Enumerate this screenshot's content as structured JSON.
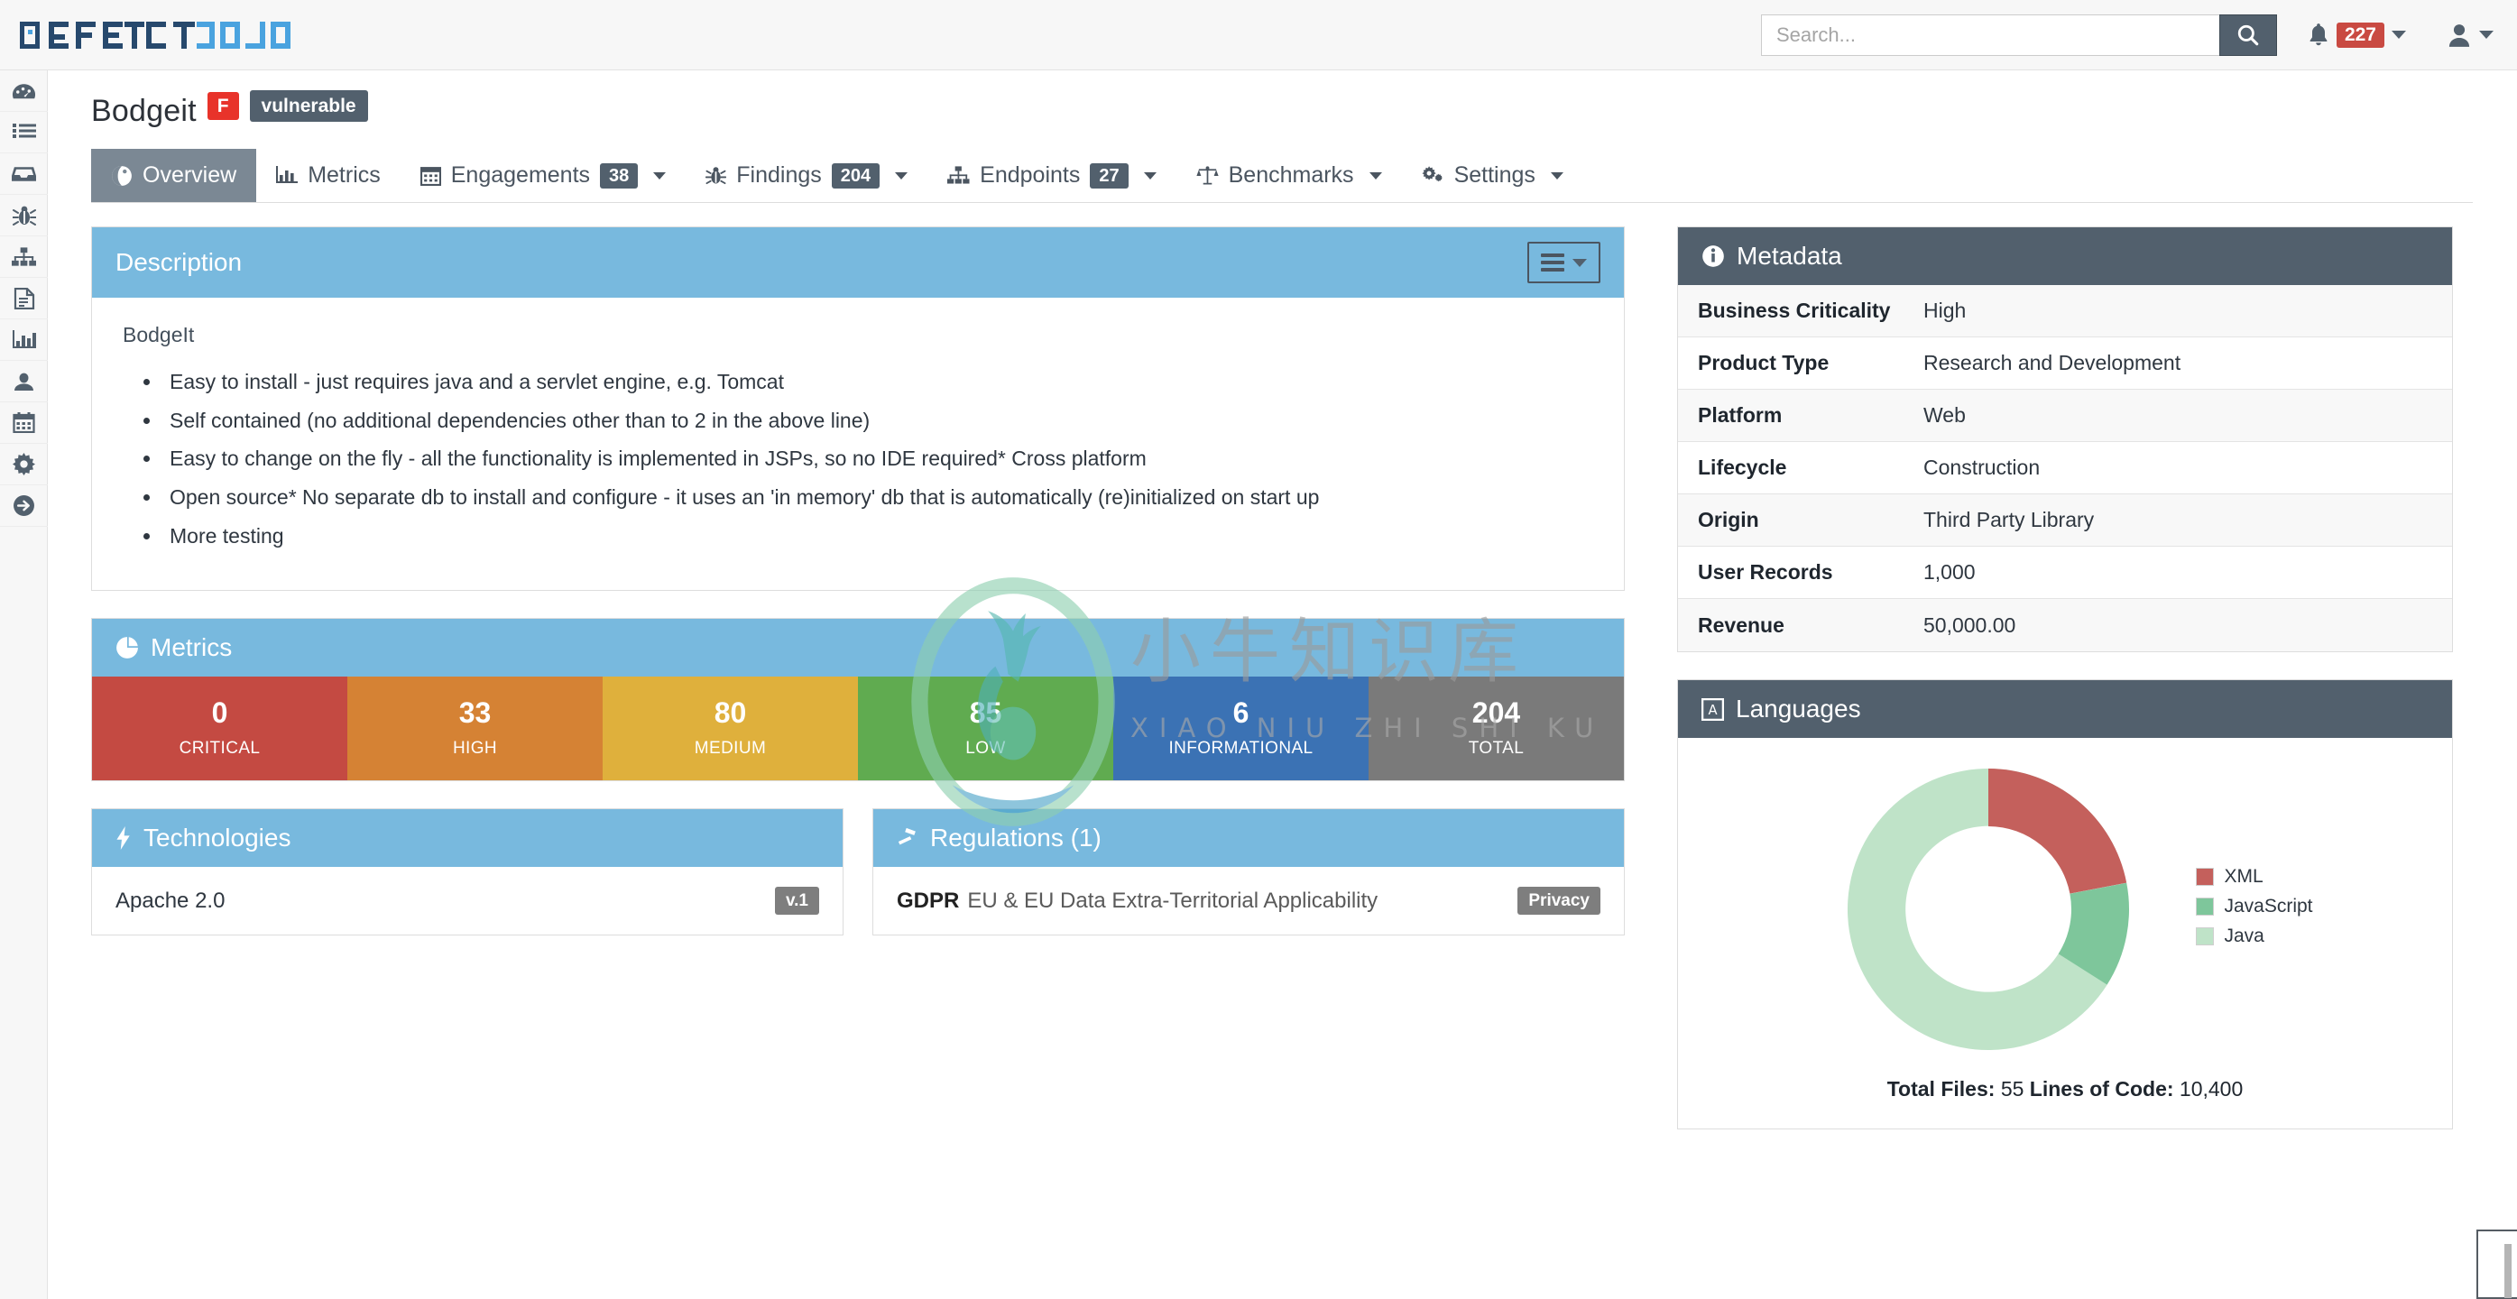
{
  "app": {
    "brand_defect": "DEFECT",
    "brand_dojo": "DOJO"
  },
  "navbar": {
    "search_placeholder": "Search...",
    "search_value": "",
    "search_icon": "search-icon",
    "notification_count": "227",
    "bell_icon": "bell-icon",
    "user_icon": "user-icon"
  },
  "sidebar": {
    "items": [
      {
        "name": "dashboard",
        "icon": "tachometer-icon"
      },
      {
        "name": "product-types",
        "icon": "list-icon"
      },
      {
        "name": "engagements",
        "icon": "inbox-icon"
      },
      {
        "name": "findings",
        "icon": "bug-icon"
      },
      {
        "name": "endpoints",
        "icon": "sitemap-icon"
      },
      {
        "name": "reports",
        "icon": "document-icon"
      },
      {
        "name": "metrics",
        "icon": "bar-chart-icon"
      },
      {
        "name": "users",
        "icon": "user-icon"
      },
      {
        "name": "calendar",
        "icon": "calendar-icon"
      },
      {
        "name": "configuration",
        "icon": "gear-icon"
      },
      {
        "name": "logout",
        "icon": "sign-out-icon"
      }
    ]
  },
  "page": {
    "title": "Bodgeit",
    "grade": "F",
    "status_badge": "vulnerable"
  },
  "tabs": [
    {
      "label": "Overview",
      "icon": "globe-icon",
      "count": null,
      "caret": false,
      "active": true
    },
    {
      "label": "Metrics",
      "icon": "bar-chart-icon",
      "count": null,
      "caret": false,
      "active": false
    },
    {
      "label": "Engagements",
      "icon": "calendar-icon",
      "count": "38",
      "caret": true,
      "active": false
    },
    {
      "label": "Findings",
      "icon": "bug-icon",
      "count": "204",
      "caret": true,
      "active": false
    },
    {
      "label": "Endpoints",
      "icon": "sitemap-icon",
      "count": "27",
      "caret": true,
      "active": false
    },
    {
      "label": "Benchmarks",
      "icon": "balance-scale-icon",
      "count": null,
      "caret": true,
      "active": false
    },
    {
      "label": "Settings",
      "icon": "gears-icon",
      "count": null,
      "caret": true,
      "active": false
    }
  ],
  "description": {
    "header": "Description",
    "menu_icon": "bars-icon",
    "subtitle": "BodgeIt",
    "bullets": [
      "Easy to install - just requires java and a servlet engine, e.g. Tomcat",
      "Self contained (no additional dependencies other than to 2 in the above line)",
      "Easy to change on the fly - all the functionality is implemented in JSPs, so no IDE required* Cross platform",
      "Open source* No separate db to install and configure - it uses an 'in memory' db that is automatically (re)initialized on start up",
      "More testing"
    ]
  },
  "metrics": {
    "header": "Metrics",
    "icon": "pie-chart-icon",
    "severities": [
      {
        "value": "0",
        "label": "CRITICAL",
        "color": "#c44a42"
      },
      {
        "value": "33",
        "label": "HIGH",
        "color": "#d58234"
      },
      {
        "value": "80",
        "label": "MEDIUM",
        "color": "#dfb03c"
      },
      {
        "value": "85",
        "label": "LOW",
        "color": "#60ab50"
      },
      {
        "value": "6",
        "label": "INFORMATIONAL",
        "color": "#3b72b4"
      },
      {
        "value": "204",
        "label": "TOTAL",
        "color": "#7a7a7a"
      }
    ]
  },
  "technologies": {
    "header": "Technologies",
    "icon": "bolt-icon",
    "items": [
      {
        "name": "Apache 2.0",
        "badge": "v.1"
      }
    ]
  },
  "regulations": {
    "header": "Regulations (1)",
    "icon": "gavel-icon",
    "items": [
      {
        "code": "GDPR",
        "description": "EU & EU Data Extra-Territorial Applicability",
        "badge": "Privacy"
      }
    ]
  },
  "metadata": {
    "header": "Metadata",
    "icon": "info-circle-icon",
    "rows": [
      {
        "key": "Business Criticality",
        "value": "High"
      },
      {
        "key": "Product Type",
        "value": "Research and Development"
      },
      {
        "key": "Platform",
        "value": "Web"
      },
      {
        "key": "Lifecycle",
        "value": "Construction"
      },
      {
        "key": "Origin",
        "value": "Third Party Library"
      },
      {
        "key": "User Records",
        "value": "1,000"
      },
      {
        "key": "Revenue",
        "value": "50,000.00"
      }
    ]
  },
  "languages": {
    "header": "Languages",
    "icon": "language-icon",
    "total_files_label": "Total Files:",
    "total_files": "55",
    "loc_label": "Lines of Code:",
    "loc": "10,400"
  },
  "chart_data": {
    "type": "pie",
    "title": "Languages",
    "categories": [
      "XML",
      "JavaScript",
      "Java"
    ],
    "values": [
      22,
      12,
      66
    ],
    "colors": [
      "#c4605c",
      "#7ec69b",
      "#bfe3c8"
    ],
    "legend_position": "right",
    "donut": true,
    "annotations": [
      "Total Files: 55",
      "Lines of Code: 10,400"
    ]
  },
  "watermark": {
    "cn": "小牛知识库",
    "pinyin": "XIAO NIU ZHI SHI KU"
  }
}
